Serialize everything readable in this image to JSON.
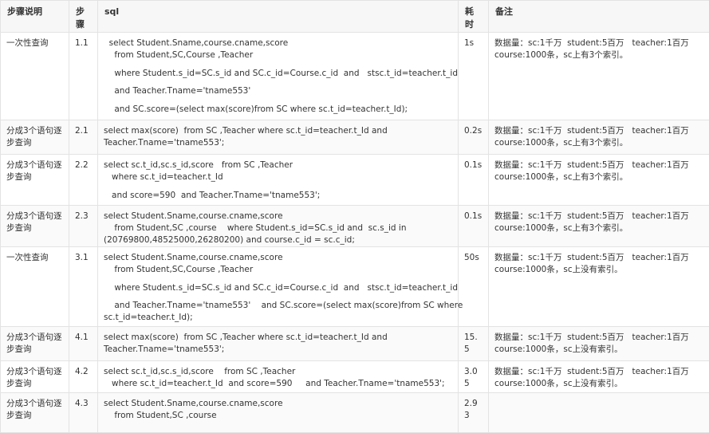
{
  "headers": [
    "步骤说明",
    "步骤",
    "sql",
    "耗时",
    "备注"
  ],
  "rows": [
    {
      "desc": "一次性查询",
      "step": "1.1",
      "sql": [
        "  select Student.Sname,course.cname,score",
        "    from Student,SC,Course ,Teacher",
        "",
        "    where Student.s_id=SC.s_id and SC.c_id=Course.c_id  and   stsc.t_id=teacher.t_id",
        "",
        "    and Teacher.Tname='tname553'",
        "",
        "    and SC.score=(select max(score)from SC where sc.t_id=teacher.t_Id);"
      ],
      "time": "1s",
      "note": [
        "数据量：sc:1千万  student:5百万   teacher:1百万",
        "course:1000条，sc上有3个索引。"
      ]
    },
    {
      "desc": "分成3个语句逐步查询",
      "step": "2.1",
      "sql": [
        "select max(score)  from SC ,Teacher where sc.t_id=teacher.t_Id and",
        "Teacher.Tname='tname553';"
      ],
      "time": "0.2s",
      "note": [
        "数据量：sc:1千万  student:5百万   teacher:1百万",
        "course:1000条，sc上有3个索引。"
      ]
    },
    {
      "desc": "分成3个语句逐步查询",
      "step": "2.2",
      "sql": [
        "select sc.t_id,sc.s_id,score   from SC ,Teacher",
        "   where sc.t_id=teacher.t_Id",
        "",
        "   and score=590  and Teacher.Tname='tname553';"
      ],
      "time": "0.1s",
      "note": [
        "数据量：sc:1千万  student:5百万   teacher:1百万",
        "course:1000条，sc上有3个索引。"
      ]
    },
    {
      "desc": "分成3个语句逐步查询",
      "step": "2.3",
      "sql": [
        "select Student.Sname,course.cname,score",
        "    from Student,SC ,course    where Student.s_id=SC.s_id and  sc.s_id in",
        "(20769800,48525000,26280200) and course.c_id = sc.c_id;"
      ],
      "time": "0.1s",
      "note": [
        "数据量：sc:1千万  student:5百万   teacher:1百万",
        "course:1000条，sc上有3个索引。"
      ]
    },
    {
      "desc": "一次性查询",
      "step": "3.1",
      "sql": [
        "select Student.Sname,course.cname,score",
        "    from Student,SC,Course ,Teacher",
        "",
        "    where Student.s_id=SC.s_id and SC.c_id=Course.c_id  and   stsc.t_id=teacher.t_id",
        "",
        "    and Teacher.Tname='tname553'    and SC.score=(select max(score)from SC where",
        "sc.t_id=teacher.t_Id);"
      ],
      "time": "50s",
      "note": [
        "数据量：sc:1千万  student:5百万   teacher:1百万",
        "course:1000条，sc上没有索引。"
      ]
    },
    {
      "desc": "分成3个语句逐步查询",
      "step": "4.1",
      "sql": [
        "select max(score)  from SC ,Teacher where sc.t_id=teacher.t_Id and",
        "Teacher.Tname='tname553';"
      ],
      "time": "15.5",
      "note": [
        "数据量：sc:1千万  student:5百万   teacher:1百万",
        "course:1000条，sc上没有索引。"
      ]
    },
    {
      "desc": "分成3个语句逐步查询",
      "step": "4.2",
      "sql": [
        "select sc.t_id,sc.s_id,score    from SC ,Teacher",
        "   where sc.t_id=teacher.t_Id  and score=590     and Teacher.Tname='tname553';"
      ],
      "time": "3.05",
      "note": [
        "数据量：sc:1千万  student:5百万   teacher:1百万",
        "course:1000条，sc上没有索引。"
      ]
    },
    {
      "desc": "分成3个语句逐步查询",
      "step": "4.3",
      "sql": [
        "select Student.Sname,course.cname,score",
        "    from Student,SC ,course"
      ],
      "time": "2.93",
      "note": []
    }
  ]
}
